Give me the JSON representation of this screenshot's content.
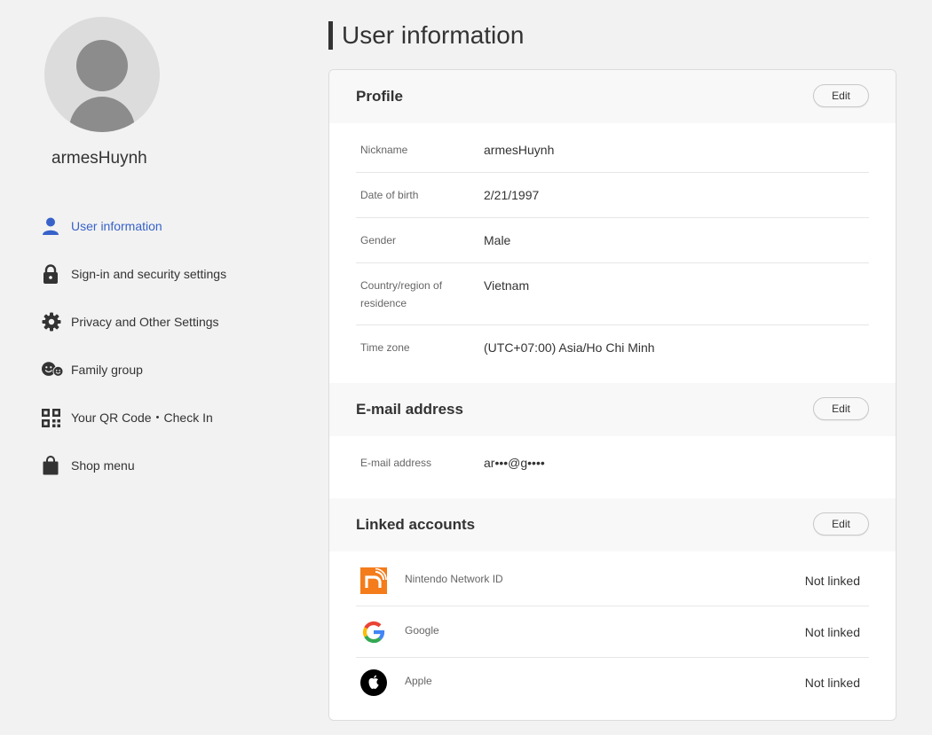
{
  "user": {
    "username": "armesHuynh"
  },
  "colors": {
    "accent": "#3762c9",
    "nintendo_orange": "#f47c1a"
  },
  "sidebar": {
    "items": [
      {
        "label": "User information",
        "icon": "user-icon",
        "active": true
      },
      {
        "label": "Sign-in and security settings",
        "icon": "lock-icon",
        "active": false
      },
      {
        "label": "Privacy and Other Settings",
        "icon": "gear-icon",
        "active": false
      },
      {
        "label": "Family group",
        "icon": "family-icon",
        "active": false
      },
      {
        "label": "Your QR Code・Check In",
        "icon": "qr-code-icon",
        "active": false
      },
      {
        "label": "Shop menu",
        "icon": "shopping-bag-icon",
        "active": false
      }
    ]
  },
  "main": {
    "title": "User information",
    "profile": {
      "title": "Profile",
      "edit_label": "Edit",
      "rows": [
        {
          "label": "Nickname",
          "value": "armesHuynh"
        },
        {
          "label": "Date of birth",
          "value": "2/21/1997"
        },
        {
          "label": "Gender",
          "value": "Male"
        },
        {
          "label": "Country/region of residence",
          "value": "Vietnam"
        },
        {
          "label": "Time zone",
          "value": "(UTC+07:00) Asia/Ho Chi Minh"
        }
      ]
    },
    "email": {
      "title": "E-mail address",
      "edit_label": "Edit",
      "label": "E-mail address",
      "value": "ar•••@g••••"
    },
    "linked": {
      "title": "Linked accounts",
      "edit_label": "Edit",
      "accounts": [
        {
          "name": "Nintendo Network ID",
          "status": "Not linked",
          "icon": "nintendo-network-icon"
        },
        {
          "name": "Google",
          "status": "Not linked",
          "icon": "google-icon"
        },
        {
          "name": "Apple",
          "status": "Not linked",
          "icon": "apple-icon"
        }
      ]
    }
  }
}
